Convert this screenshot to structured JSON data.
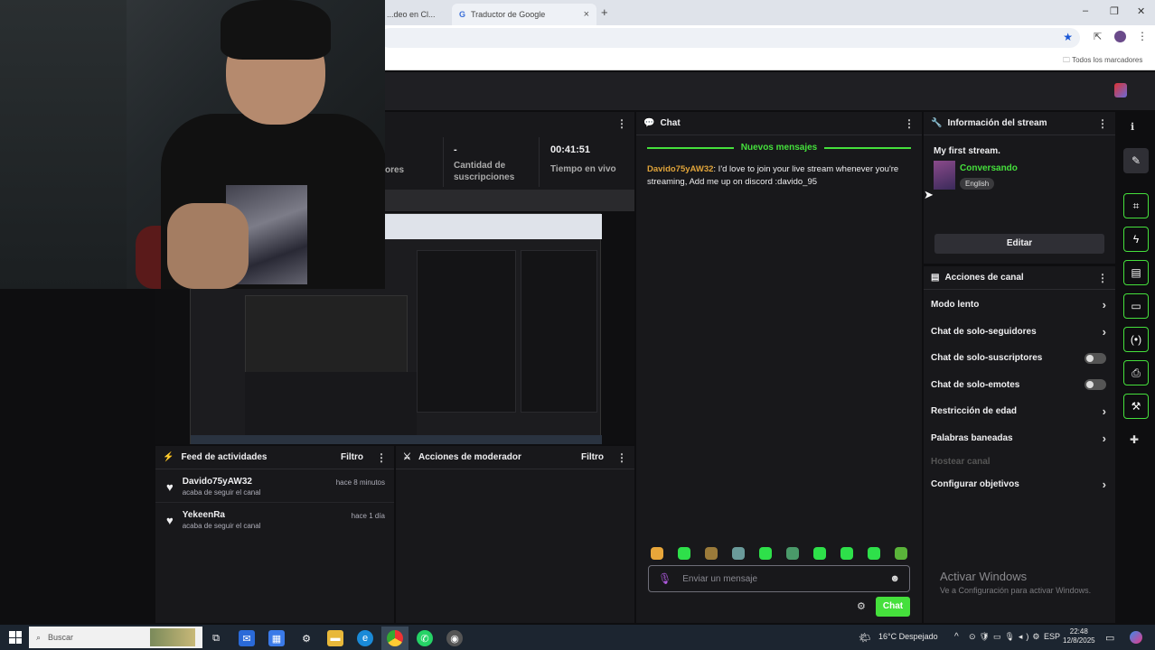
{
  "browser": {
    "tabs": [
      {
        "label": "...deo en Cl...",
        "close": "×"
      },
      {
        "label": "Traductor de Google",
        "close": "×"
      }
    ],
    "new_tab": "+",
    "bookmarks_label": "Todos los marcadores",
    "window_controls": [
      "–",
      "❐",
      "✕"
    ]
  },
  "stats": {
    "partial_label": "ores",
    "subs_value": "-",
    "subs_label": "Cantidad de suscripciones",
    "live_value": "00:41:51",
    "live_label": "Tiempo en vivo"
  },
  "chat": {
    "title": "Chat",
    "new_messages": "Nuevos mensajes",
    "messages": [
      {
        "user": "Davido75yAW32",
        "text": ": I'd love to join your live stream whenever you're streaming, Add me up on discord :davido_95"
      }
    ],
    "input_placeholder": "Enviar un mensaje",
    "send_label": "Chat"
  },
  "stream_info": {
    "title": "Información del stream",
    "stream_title": "My first stream.",
    "category": "Conversando",
    "tag": "English",
    "edit_label": "Editar"
  },
  "channel_actions": {
    "title": "Acciones de canal",
    "items": [
      {
        "label": "Modo lento",
        "control": "chevron"
      },
      {
        "label": "Chat de solo-seguidores",
        "control": "chevron"
      },
      {
        "label": "Chat de solo-suscriptores",
        "control": "toggle"
      },
      {
        "label": "Chat de solo-emotes",
        "control": "toggle"
      },
      {
        "label": "Restricción de edad",
        "control": "chevron"
      },
      {
        "label": "Palabras baneadas",
        "control": "chevron"
      },
      {
        "label": "Hostear canal",
        "control": "disabled"
      },
      {
        "label": "Configurar objetivos",
        "control": "chevron"
      }
    ]
  },
  "activity_feed": {
    "title": "Feed de actividades",
    "filter": "Filtro",
    "items": [
      {
        "name": "Davido75yAW32",
        "sub": "acaba de seguir el canal",
        "time": "hace 8 minutos"
      },
      {
        "name": "YekeenRa",
        "sub": "acaba de seguir el canal",
        "time": "hace 1 día"
      }
    ]
  },
  "mod_actions": {
    "title": "Acciones de moderador",
    "filter": "Filtro"
  },
  "windows_activation": {
    "line1": "Activar Windows",
    "line2": "Ve a Configuración para activar Windows."
  },
  "taskbar": {
    "search_placeholder": "Buscar",
    "weather": "16°C  Despejado",
    "lang": "ESP",
    "time": "22:48",
    "date": "12/8/2025"
  },
  "colors": {
    "accent_green": "#45e03c",
    "username_orange": "#e0a43a",
    "panel_bg": "#18181b"
  }
}
